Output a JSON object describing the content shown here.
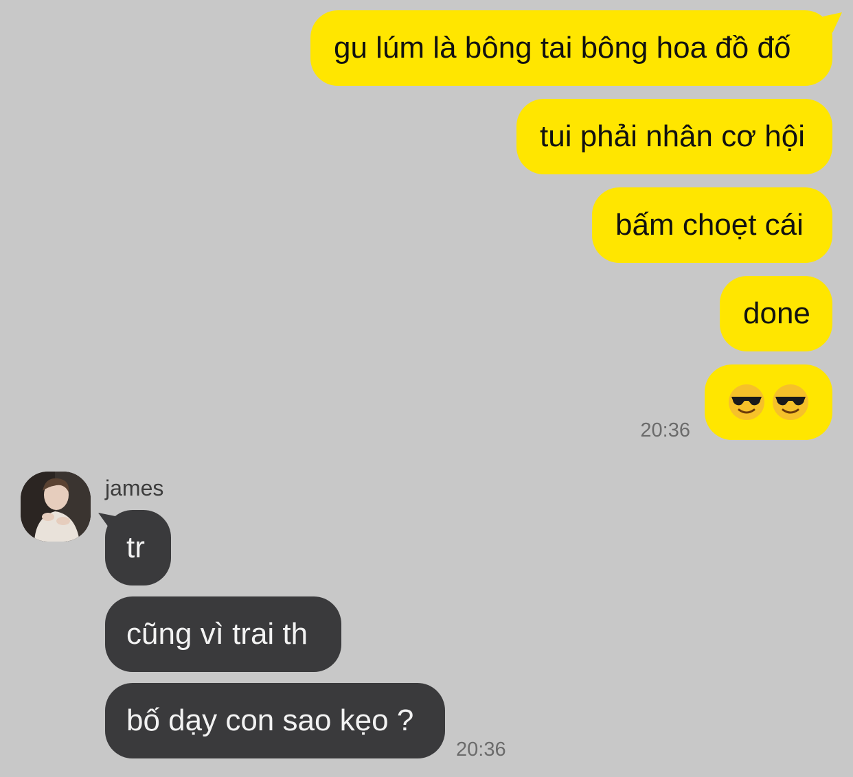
{
  "chat": {
    "outgoing": [
      {
        "text": "gu lúm là bông tai bông hoa đồ đố"
      },
      {
        "text": "tui phải nhân cơ hội"
      },
      {
        "text": "bấm choẹt cái"
      },
      {
        "text": "done"
      },
      {
        "emoji": [
          "smiling-face-with-sunglasses",
          "smiling-face-with-sunglasses"
        ]
      }
    ],
    "outgoing_time": "20:36",
    "incoming_sender": "james",
    "incoming": [
      {
        "text": "tr"
      },
      {
        "text": "cũng vì trai th"
      },
      {
        "text": "bố dạy con sao kẹo ?"
      }
    ],
    "incoming_time": "20:36"
  },
  "colors": {
    "background": "#c8c8c8",
    "outgoing_bubble": "#ffe600",
    "incoming_bubble": "#3a3a3c",
    "timestamp": "#6b6b6b"
  }
}
